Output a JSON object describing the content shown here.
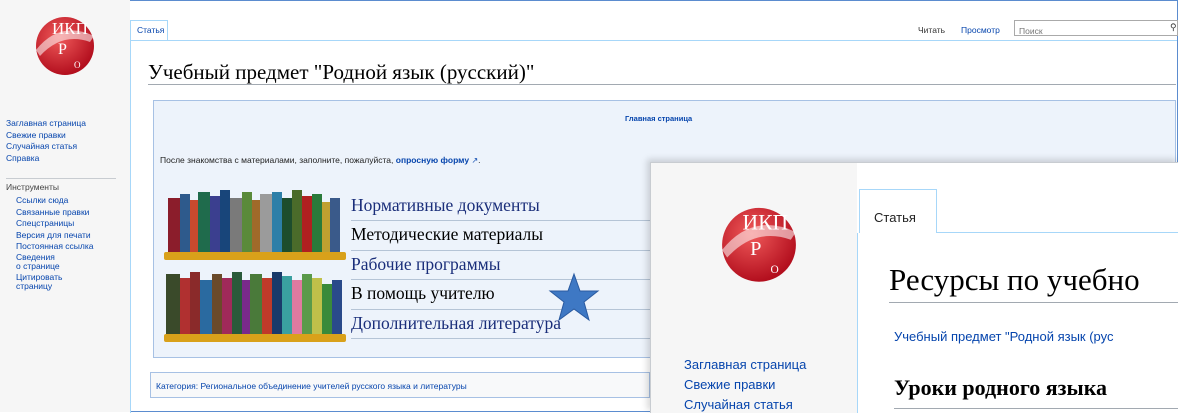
{
  "logo": {
    "text_top": "ИКП",
    "text_mid": "Р",
    "text_bottom": "О"
  },
  "sidebar": {
    "nav": [
      "Заглавная страница",
      "Свежие правки",
      "Случайная статья",
      "Справка"
    ],
    "tools_title": "Инструменты",
    "tools": [
      "Ссылки сюда",
      "Связанные правки",
      "Спецстраницы",
      "Версия для печати",
      "Постоянная ссылка"
    ],
    "tools_wrapped": [
      {
        "line1": "Сведения",
        "line2": "о странице"
      },
      {
        "line1": "Цитировать",
        "line2": "страницу"
      }
    ]
  },
  "tabs": {
    "article": "Статья",
    "read": "Читать",
    "view": "Просмотр"
  },
  "search": {
    "placeholder": "Поиск",
    "icon": "search-icon"
  },
  "page": {
    "title": "Учебный предмет \"Родной язык (русский)\"",
    "main_link": "Главная страница",
    "survey_prefix": "После знакомства с материалами, заполните, пожалуйста, ",
    "survey_link": "опросную форму",
    "survey_suffix": ".",
    "menu": [
      "Нормативные документы",
      "Методические материалы",
      "Рабочие программы",
      "В помощь учителю",
      "Дополнительная литература"
    ],
    "category_label": "Категория:",
    "category_value": "Региональное объединение учителей русского языка и литературы"
  },
  "overlay": {
    "tab": "Статья",
    "title": "Ресурсы по учебно",
    "subtitle": "Учебный предмет \"Родной язык (рус",
    "heading": "Уроки родного языка",
    "nav": [
      "Заглавная страница",
      "Свежие правки",
      "Случайная статья"
    ]
  },
  "colors": {
    "link": "#0645ad",
    "menu_text": "#1a2e7a",
    "box_bg": "#edf3fb",
    "logo_red": "#c8102e",
    "star": "#3e78c4"
  }
}
